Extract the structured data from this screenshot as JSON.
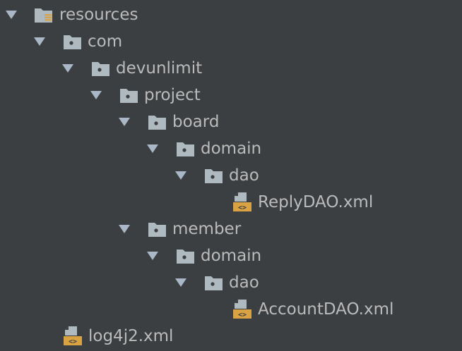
{
  "tree": {
    "nodes": [
      {
        "label": "resources",
        "kind": "resources-folder",
        "expanded": true
      },
      {
        "label": "com",
        "kind": "package",
        "expanded": true
      },
      {
        "label": "devunlimit",
        "kind": "package",
        "expanded": true
      },
      {
        "label": "project",
        "kind": "package",
        "expanded": true
      },
      {
        "label": "board",
        "kind": "package",
        "expanded": true
      },
      {
        "label": "domain",
        "kind": "package",
        "expanded": true
      },
      {
        "label": "dao",
        "kind": "package",
        "expanded": true
      },
      {
        "label": "ReplyDAO.xml",
        "kind": "xml-file"
      },
      {
        "label": "member",
        "kind": "package",
        "expanded": true
      },
      {
        "label": "domain",
        "kind": "package",
        "expanded": true
      },
      {
        "label": "dao",
        "kind": "package",
        "expanded": true
      },
      {
        "label": "AccountDAO.xml",
        "kind": "xml-file"
      },
      {
        "label": "log4j2.xml",
        "kind": "xml-file"
      }
    ]
  },
  "colors": {
    "background": "#3c3f41",
    "text": "#bbbbbb",
    "arrow": "#a9b7c6",
    "folder": "#aeb9c0",
    "xml_badge": "#d9a343"
  },
  "icons": {
    "arrow": "expand-arrow-icon",
    "package": "package-folder-icon",
    "resources": "resources-folder-icon",
    "xml": "xml-file-icon"
  }
}
